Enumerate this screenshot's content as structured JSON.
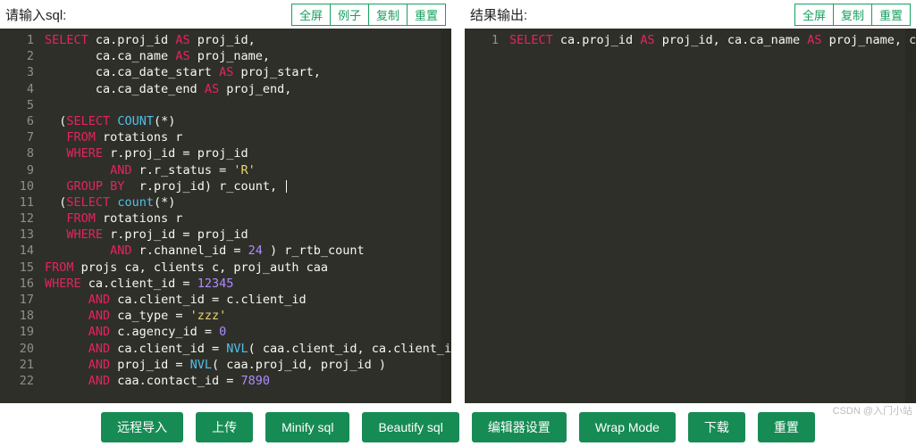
{
  "left": {
    "title": "请输入sql:",
    "buttons": [
      "全屏",
      "例子",
      "复制",
      "重置"
    ],
    "lines": [
      [
        [
          "kw",
          "SELECT"
        ],
        [
          "id",
          " ca.proj_id "
        ],
        [
          "kw",
          "AS"
        ],
        [
          "id",
          " proj_id,"
        ]
      ],
      [
        [
          "id",
          "       ca.ca_name "
        ],
        [
          "kw",
          "AS"
        ],
        [
          "id",
          " proj_name,"
        ]
      ],
      [
        [
          "id",
          "       ca.ca_date_start "
        ],
        [
          "kw",
          "AS"
        ],
        [
          "id",
          " proj_start,"
        ]
      ],
      [
        [
          "id",
          "       ca.ca_date_end "
        ],
        [
          "kw",
          "AS"
        ],
        [
          "id",
          " proj_end,"
        ]
      ],
      [
        [
          "id",
          ""
        ]
      ],
      [
        [
          "id",
          "  ("
        ],
        [
          "kw",
          "SELECT"
        ],
        [
          "id",
          " "
        ],
        [
          "fn",
          "COUNT"
        ],
        [
          "id",
          "(*)"
        ]
      ],
      [
        [
          "id",
          "   "
        ],
        [
          "kw",
          "FROM"
        ],
        [
          "id",
          " rotations r"
        ]
      ],
      [
        [
          "id",
          "   "
        ],
        [
          "kw",
          "WHERE"
        ],
        [
          "id",
          " r.proj_id = proj_id"
        ]
      ],
      [
        [
          "id",
          "         "
        ],
        [
          "kw",
          "AND"
        ],
        [
          "id",
          " r.r_status = "
        ],
        [
          "str",
          "'R'"
        ]
      ],
      [
        [
          "id",
          "   "
        ],
        [
          "kw",
          "GROUP"
        ],
        [
          "id",
          " "
        ],
        [
          "kw",
          "BY"
        ],
        [
          "id",
          "  r.proj_id) r_count, "
        ],
        [
          "cursor",
          ""
        ]
      ],
      [
        [
          "id",
          "  ("
        ],
        [
          "kw",
          "SELECT"
        ],
        [
          "id",
          " "
        ],
        [
          "fn",
          "count"
        ],
        [
          "id",
          "(*)"
        ]
      ],
      [
        [
          "id",
          "   "
        ],
        [
          "kw",
          "FROM"
        ],
        [
          "id",
          " rotations r"
        ]
      ],
      [
        [
          "id",
          "   "
        ],
        [
          "kw",
          "WHERE"
        ],
        [
          "id",
          " r.proj_id = proj_id"
        ]
      ],
      [
        [
          "id",
          "         "
        ],
        [
          "kw",
          "AND"
        ],
        [
          "id",
          " r.channel_id = "
        ],
        [
          "num",
          "24"
        ],
        [
          "id",
          " ) r_rtb_count"
        ]
      ],
      [
        [
          "kw",
          "FROM"
        ],
        [
          "id",
          " projs ca, clients c, proj_auth caa"
        ]
      ],
      [
        [
          "kw",
          "WHERE"
        ],
        [
          "id",
          " ca.client_id = "
        ],
        [
          "num",
          "12345"
        ]
      ],
      [
        [
          "id",
          "      "
        ],
        [
          "kw",
          "AND"
        ],
        [
          "id",
          " ca.client_id = c.client_id"
        ]
      ],
      [
        [
          "id",
          "      "
        ],
        [
          "kw",
          "AND"
        ],
        [
          "id",
          " ca_type = "
        ],
        [
          "str",
          "'zzz'"
        ]
      ],
      [
        [
          "id",
          "      "
        ],
        [
          "kw",
          "AND"
        ],
        [
          "id",
          " c.agency_id = "
        ],
        [
          "num",
          "0"
        ]
      ],
      [
        [
          "id",
          "      "
        ],
        [
          "kw",
          "AND"
        ],
        [
          "id",
          " ca.client_id = "
        ],
        [
          "fn",
          "NVL"
        ],
        [
          "id",
          "( caa.client_id, ca.client_id )"
        ]
      ],
      [
        [
          "id",
          "      "
        ],
        [
          "kw",
          "AND"
        ],
        [
          "id",
          " proj_id = "
        ],
        [
          "fn",
          "NVL"
        ],
        [
          "id",
          "( caa.proj_id, proj_id )"
        ]
      ],
      [
        [
          "id",
          "      "
        ],
        [
          "kw",
          "AND"
        ],
        [
          "id",
          " caa.contact_id = "
        ],
        [
          "num",
          "7890"
        ]
      ]
    ]
  },
  "right": {
    "title": "结果输出:",
    "buttons": [
      "全屏",
      "复制",
      "重置"
    ],
    "lines": [
      [
        [
          "kw",
          "SELECT"
        ],
        [
          "id",
          " ca.proj_id "
        ],
        [
          "kw",
          "AS"
        ],
        [
          "id",
          " proj_id, ca.ca_name "
        ],
        [
          "kw",
          "AS"
        ],
        [
          "id",
          " proj_name, ca.ca_date_st"
        ]
      ]
    ]
  },
  "footer": [
    "远程导入",
    "上传",
    "Minify sql",
    "Beautify sql",
    "编辑器设置",
    "Wrap Mode",
    "下载",
    "重置"
  ],
  "watermark": "CSDN @入门小站"
}
